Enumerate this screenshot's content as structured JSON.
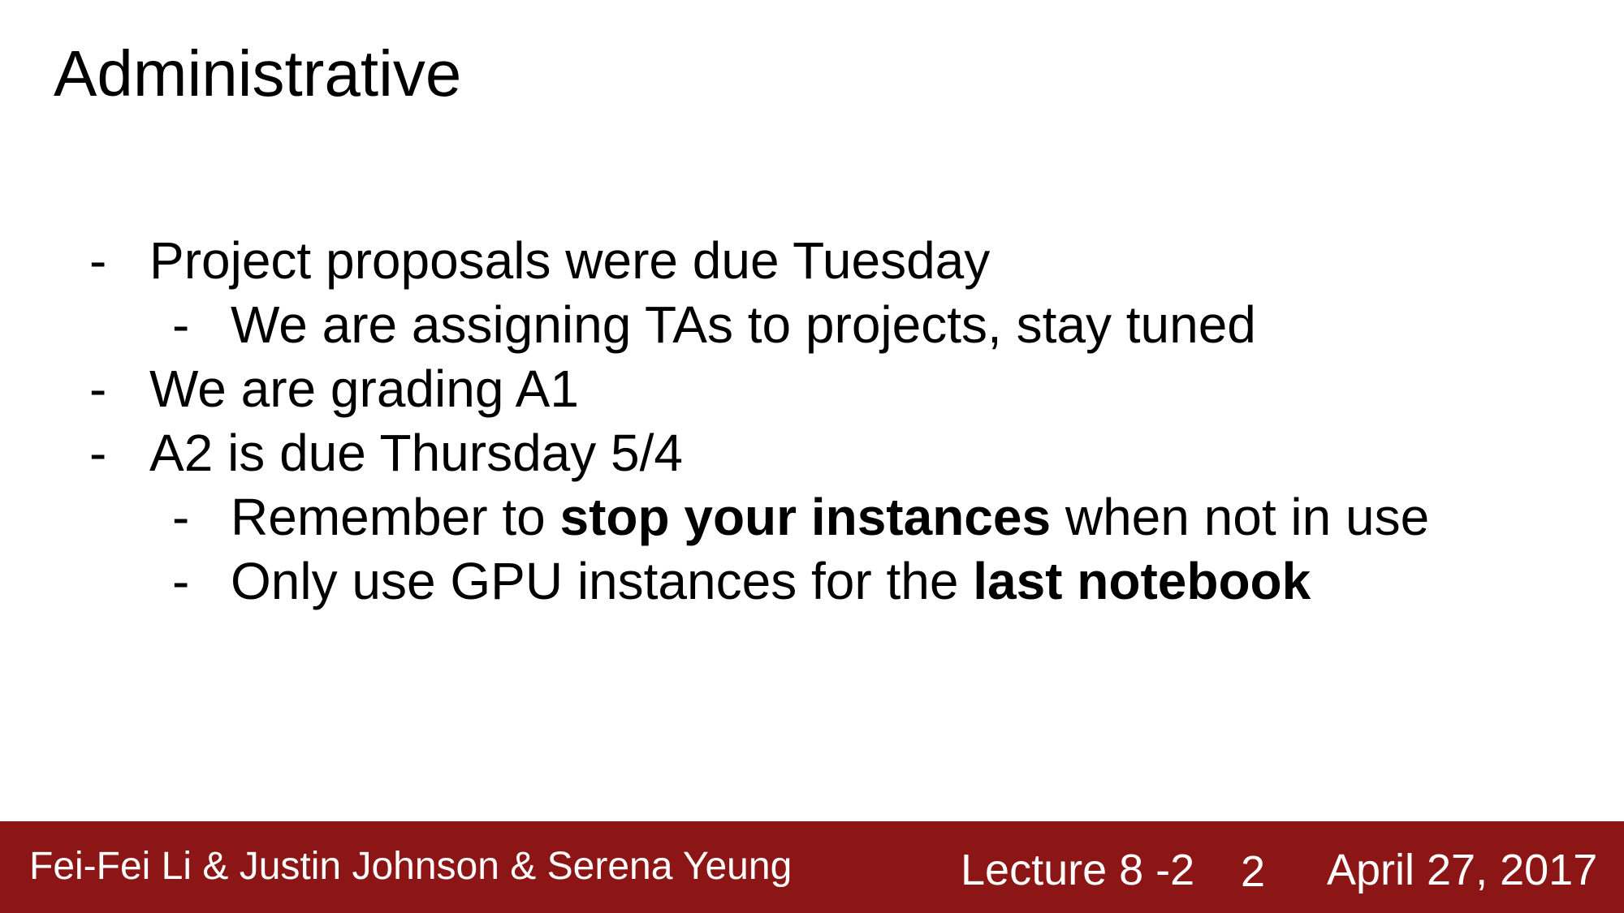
{
  "slide": {
    "title": "Administrative",
    "bullets": [
      {
        "level": 1,
        "parts": [
          {
            "text": "Project proposals were due Tuesday",
            "bold": false
          }
        ]
      },
      {
        "level": 2,
        "parts": [
          {
            "text": "We are assigning TAs to projects, stay tuned",
            "bold": false
          }
        ]
      },
      {
        "level": 1,
        "parts": [
          {
            "text": "We are grading A1",
            "bold": false
          }
        ]
      },
      {
        "level": 1,
        "parts": [
          {
            "text": "A2 is due Thursday 5/4",
            "bold": false
          }
        ]
      },
      {
        "level": 2,
        "parts": [
          {
            "text": "Remember to ",
            "bold": false
          },
          {
            "text": "stop your instances",
            "bold": true
          },
          {
            "text": " when not in use",
            "bold": false
          }
        ]
      },
      {
        "level": 2,
        "parts": [
          {
            "text": "Only use GPU instances for the ",
            "bold": false
          },
          {
            "text": "last notebook",
            "bold": true
          }
        ]
      }
    ],
    "bullet_marker": "-"
  },
  "footer": {
    "authors": "Fei-Fei Li & Justin Johnson & Serena Yeung",
    "lecture": "Lecture 8 -",
    "lecture_page": "2",
    "page_number": "2",
    "date": "April 27, 2017",
    "background_color": "#8c1515",
    "text_color": "#ffffff"
  }
}
